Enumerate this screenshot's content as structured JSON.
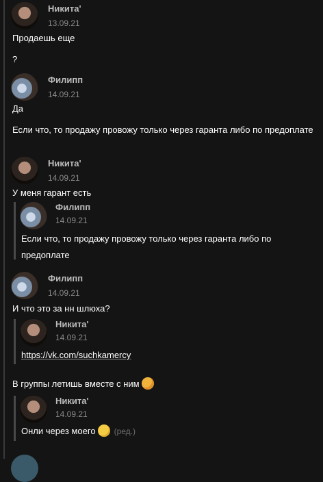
{
  "messages": [
    {
      "author": "Никита'",
      "date": "13.09.21",
      "lines": [
        "Продаешь еще",
        "?"
      ]
    },
    {
      "author": "Филипп",
      "date": "14.09.21",
      "lines": [
        "Да",
        "Если что, то продажу провожу только через гаранта либо по предоплате"
      ]
    },
    {
      "author": "Никита'",
      "date": "14.09.21",
      "lines": [
        "У меня гарант есть"
      ],
      "quote": {
        "author": "Филипп",
        "date": "14.09.21",
        "text": "Если что, то продажу провожу только через гаранта либо по предоплате"
      }
    },
    {
      "author": "Филипп",
      "date": "14.09.21",
      "lines": [
        "И что это за нн шлюха?"
      ],
      "quote": {
        "author": "Никита'",
        "date": "14.09.21",
        "text": "https://vk.com/suchkamercy"
      },
      "after_quote": "В группы летишь вместе с ним",
      "quote2": {
        "author": "Никита'",
        "date": "14.09.21",
        "text": "Онли через моего",
        "edited": "(ред.)"
      }
    }
  ],
  "icons": {
    "emoji_after_group_text": "kissing-emoji",
    "emoji_after_only": "smile-emoji"
  }
}
